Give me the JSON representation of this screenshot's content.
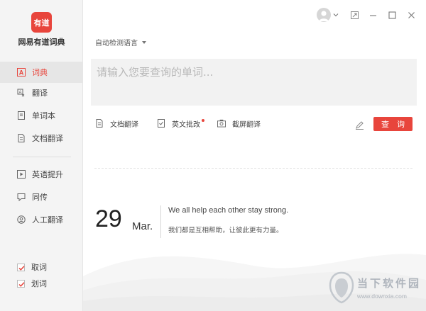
{
  "app": {
    "logo_text": "有道",
    "name": "网易有道词典"
  },
  "sidebar": {
    "items": [
      {
        "label": "词典",
        "icon": "dict-a-icon",
        "active": true
      },
      {
        "label": "翻译",
        "icon": "translate-icon",
        "active": false
      },
      {
        "label": "单词本",
        "icon": "wordbook-icon",
        "active": false
      },
      {
        "label": "文档翻译",
        "icon": "document-icon",
        "active": false
      },
      {
        "label": "英语提升",
        "icon": "play-icon",
        "active": false
      },
      {
        "label": "同传",
        "icon": "simultaneous-icon",
        "active": false
      },
      {
        "label": "人工翻译",
        "icon": "human-translate-icon",
        "active": false
      }
    ],
    "checks": [
      {
        "label": "取词",
        "checked": true
      },
      {
        "label": "划词",
        "checked": true
      }
    ]
  },
  "main": {
    "lang_select": "自动检测语言",
    "search_placeholder": "请输入您要查询的单词...",
    "tools": [
      {
        "label": "文档翻译",
        "icon": "doc-translate-icon"
      },
      {
        "label": "英文批改",
        "icon": "correction-icon",
        "badge": true
      },
      {
        "label": "截屏翻译",
        "icon": "screenshot-icon"
      }
    ],
    "query_button": "查 询"
  },
  "daily": {
    "day": "29",
    "month": "Mar.",
    "quote_en": "We all help each other stay strong.",
    "quote_zh": "我们都是互相帮助，让彼此更有力量。"
  },
  "watermark": {
    "cn": "当下软件园",
    "en": "www.downxia.com"
  },
  "colors": {
    "accent": "#e8453c",
    "sidebar_bg": "#f4f4f4",
    "search_bg": "#f2f2f2"
  }
}
